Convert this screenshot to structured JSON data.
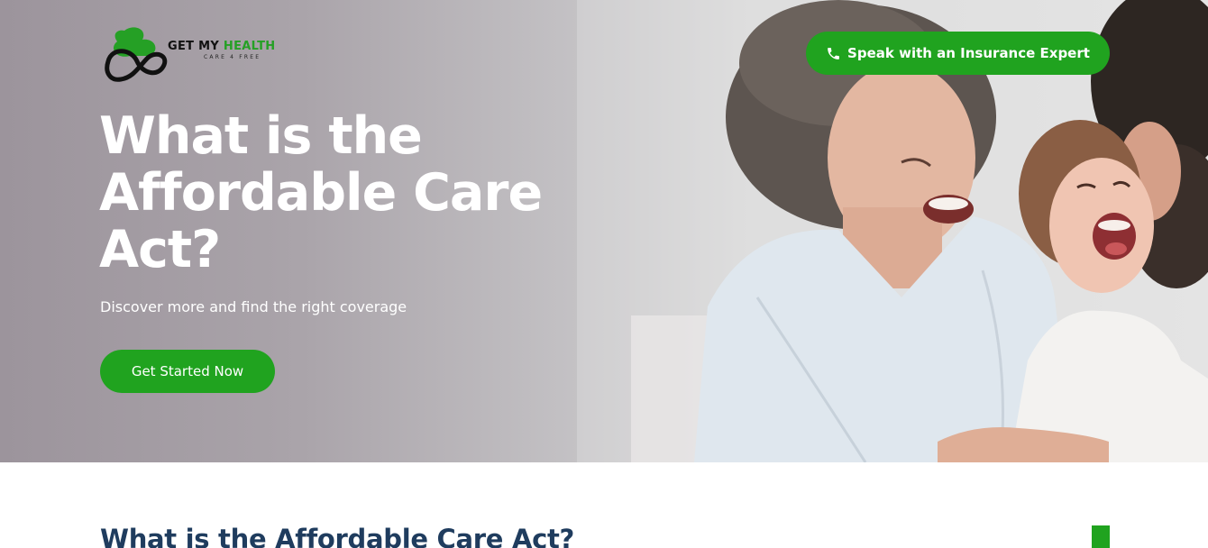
{
  "brand": {
    "name_part1": "GET MY ",
    "name_part2": "HEALTH",
    "tagline": "CARE 4 FREE",
    "colors": {
      "green": "#20a31f",
      "dark": "#111111"
    }
  },
  "header": {
    "expert_button_label": "Speak with an Insurance Expert",
    "expert_button_icon": "phone-icon"
  },
  "hero": {
    "title_line1": "What is the",
    "title_line2": "Affordable Care",
    "title_line3": "Act?",
    "subtitle": "Discover more and find the right coverage",
    "cta_label": "Get Started Now"
  },
  "section": {
    "title": "What is the Affordable Care Act?"
  },
  "colors": {
    "accent_green": "#20a31f",
    "heading_navy": "#1f3c5e",
    "hero_text": "#ffffff"
  }
}
